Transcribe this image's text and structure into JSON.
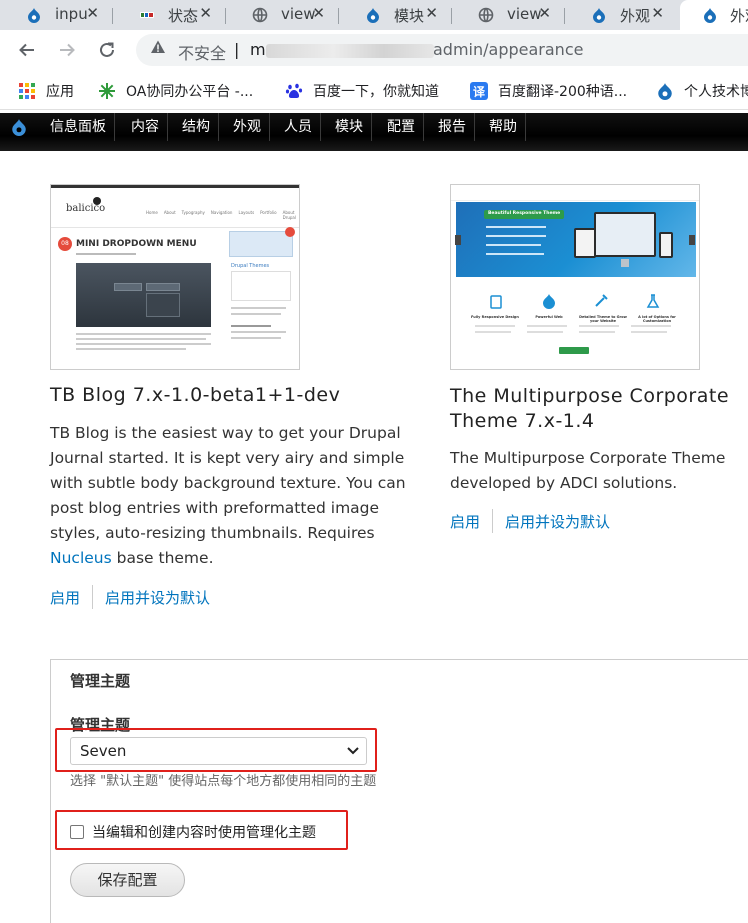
{
  "tabs": [
    {
      "title": "inpu",
      "icon": "drupal-icon"
    },
    {
      "title": "状态",
      "icon": "jreic-icon"
    },
    {
      "title": "view",
      "icon": "globe-icon"
    },
    {
      "title": "模块",
      "icon": "drupal-icon"
    },
    {
      "title": "view",
      "icon": "globe-icon"
    },
    {
      "title": "外观",
      "icon": "drupal-icon"
    },
    {
      "title": "外观",
      "icon": "drupal-icon"
    }
  ],
  "tab_close_glyph": "✕",
  "address": {
    "insecure_label": "不安全",
    "divider": "|",
    "url_prefix": "m",
    "url_suffix": "admin/appearance"
  },
  "bookmarks": [
    {
      "label": "应用",
      "icon": "apps-grid-icon"
    },
    {
      "label": "OA协同办公平台 -...",
      "icon": "oa-icon"
    },
    {
      "label": "百度一下，你就知道",
      "icon": "baidu-paw-icon"
    },
    {
      "label": "百度翻译-200种语...",
      "icon": "translate-icon"
    },
    {
      "label": "个人技术博",
      "icon": "drupal-icon"
    }
  ],
  "admin_menu": [
    "信息面板",
    "内容",
    "结构",
    "外观",
    "人员",
    "模块",
    "配置",
    "报告",
    "帮助"
  ],
  "themes": [
    {
      "title": "TB Blog 7.x-1.0-beta1+1-dev",
      "desc_before_link": "TB Blog is the easiest way to get your Drupal Journal started. It is kept very airy and simple with subtle body background texture. You can post blog entries with preformatted image styles, auto-resizing thumbnails. Requires ",
      "desc_link": "Nucleus",
      "desc_after_link": " base theme.",
      "enable": "启用",
      "enable_default": "启用并设为默认",
      "screenshot": {
        "logo": "balicico",
        "post_title": "MINI DROPDOWN MENU",
        "date_badge": "08",
        "sidebar_heading": "Drupal Themes",
        "menu_items": [
          "Home",
          "About",
          "Typography",
          "Navigation",
          "Layouts",
          "Portfolio",
          "About Drupal"
        ]
      }
    },
    {
      "title": "The Multipurpose Corporate Theme 7.x-1.4",
      "desc": "The Multipurpose Corporate Theme developed by ADCI solutions.",
      "enable": "启用",
      "enable_default": "启用并设为默认",
      "screenshot": {
        "banner_heading": "Beautiful Responsive Theme",
        "features": [
          "Fully Responsive Design",
          "Powerful Web",
          "Detailed Theme to Grow your Website",
          "A lot of Options for Customization"
        ]
      }
    }
  ],
  "admin_theme": {
    "legend": "管理主题",
    "label": "管理主题",
    "selected": "Seven",
    "help": "选择 \"默认主题\" 使得站点每个地方都使用相同的主题",
    "checkbox_label": "当编辑和创建内容时使用管理化主题",
    "checkbox_checked": false,
    "save_button": "保存配置"
  },
  "colors": {
    "link": "#0074bd",
    "highlight": "#e0201b",
    "drupal_blue": "#1b6fb9"
  }
}
